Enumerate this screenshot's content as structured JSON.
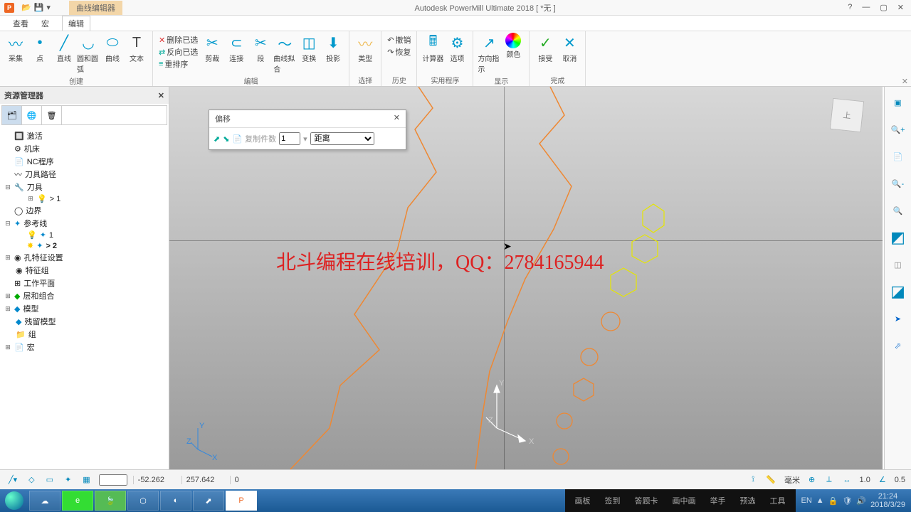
{
  "titlebar": {
    "context_tab": "曲线编辑器",
    "title": "Autodesk PowerMill Ultimate 2018   [ *无 ]"
  },
  "menubar": {
    "view": "查看",
    "macro": "宏",
    "edit": "编辑"
  },
  "ribbon": {
    "group_create": {
      "label": "创建",
      "tools": [
        "采集",
        "点",
        "直线",
        "圆和圆弧",
        "曲线",
        "文本"
      ]
    },
    "group_edit": {
      "label": "编辑",
      "delete_sel": "删除已选",
      "reverse_sel": "反向已选",
      "resort": "重排序",
      "tools": [
        "剪裁",
        "连接",
        "段",
        "曲线拟合",
        "变换",
        "投影"
      ]
    },
    "group_type": {
      "label": "",
      "tool": "类型"
    },
    "group_select": {
      "label": "选择",
      "undo": "撤销",
      "redo": "恢复"
    },
    "group_history": {
      "label": "历史"
    },
    "group_util": {
      "label": "实用程序",
      "calc": "计算器",
      "opts": "选项"
    },
    "group_display": {
      "label": "显示",
      "dir": "方向指示",
      "color": "颜色"
    },
    "group_done": {
      "label": "完成",
      "accept": "接受",
      "cancel": "取消"
    }
  },
  "explorer": {
    "title": "资源管理器",
    "nodes": {
      "active": "激活",
      "machine": "机床",
      "nc": "NC程序",
      "toolpath": "刀具路径",
      "tools": "刀具",
      "tool1": "> 1",
      "boundary": "边界",
      "refline": "参考线",
      "ref1": "1",
      "ref2": "> 2",
      "holes": "孔特征设置",
      "featgrp": "特征组",
      "workplane": "工作平面",
      "layers": "层和组合",
      "model": "模型",
      "residual": "残留模型",
      "group": "组",
      "macro": "宏"
    }
  },
  "float": {
    "title": "偏移",
    "copies_lbl": "复制件数",
    "copies_val": "1",
    "dist": "距离"
  },
  "overlay": "北斗编程在线培训，QQ：2784165944",
  "axes": {
    "x": "X",
    "y": "Y",
    "z": "Z"
  },
  "statusbar": {
    "x": "-52.262",
    "y": "257.642",
    "z": "0",
    "unit": "毫米",
    "v1": "1.0",
    "v2": "0.5"
  },
  "taskbar": {
    "items": [
      "画板",
      "签到",
      "答题卡",
      "画中画",
      "举手",
      "预选",
      "工具"
    ],
    "time": "21:24",
    "date": "2018/3/29"
  },
  "viewcube": "上"
}
